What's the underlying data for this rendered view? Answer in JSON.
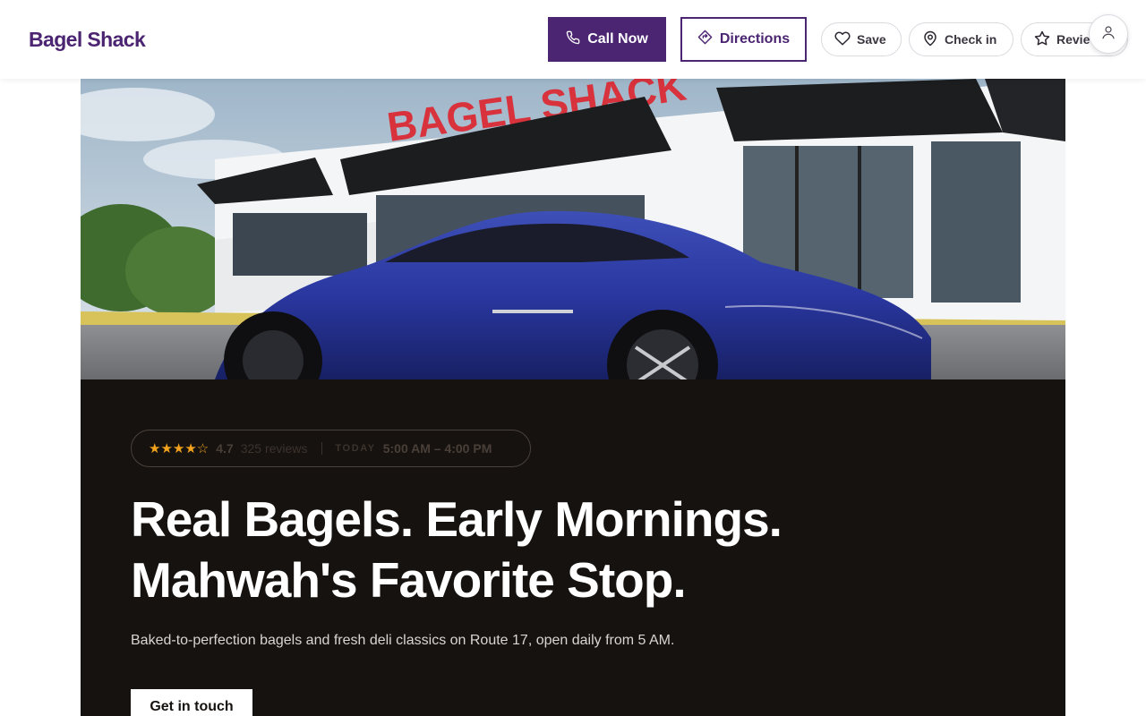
{
  "header": {
    "brand": "Bagel Shack",
    "call_label": "Call Now",
    "directions_label": "Directions",
    "save_label": "Save",
    "checkin_label": "Check in",
    "review_label": "Review"
  },
  "hero": {
    "sign_text": "BAGEL SHACK"
  },
  "info": {
    "stars": "★★★★☆",
    "rating": "4.7",
    "reviews": "325 reviews",
    "today_label": "TODAY",
    "hours": "5:00 AM – 4:00 PM"
  },
  "main": {
    "headline_line1": "Real Bagels. Early Mornings.",
    "headline_line2": "Mahwah's Favorite Stop.",
    "subtext": "Baked-to-perfection bagels and fresh deli classics on Route 17, open daily from 5 AM.",
    "cta_label": "Get in touch"
  },
  "colors": {
    "brand": "#4b2472",
    "panel": "#16120f",
    "star": "#f2a31b"
  },
  "icons": [
    "phone-icon",
    "directions-icon",
    "heart-icon",
    "map-pin-icon",
    "star-icon",
    "user-icon"
  ]
}
